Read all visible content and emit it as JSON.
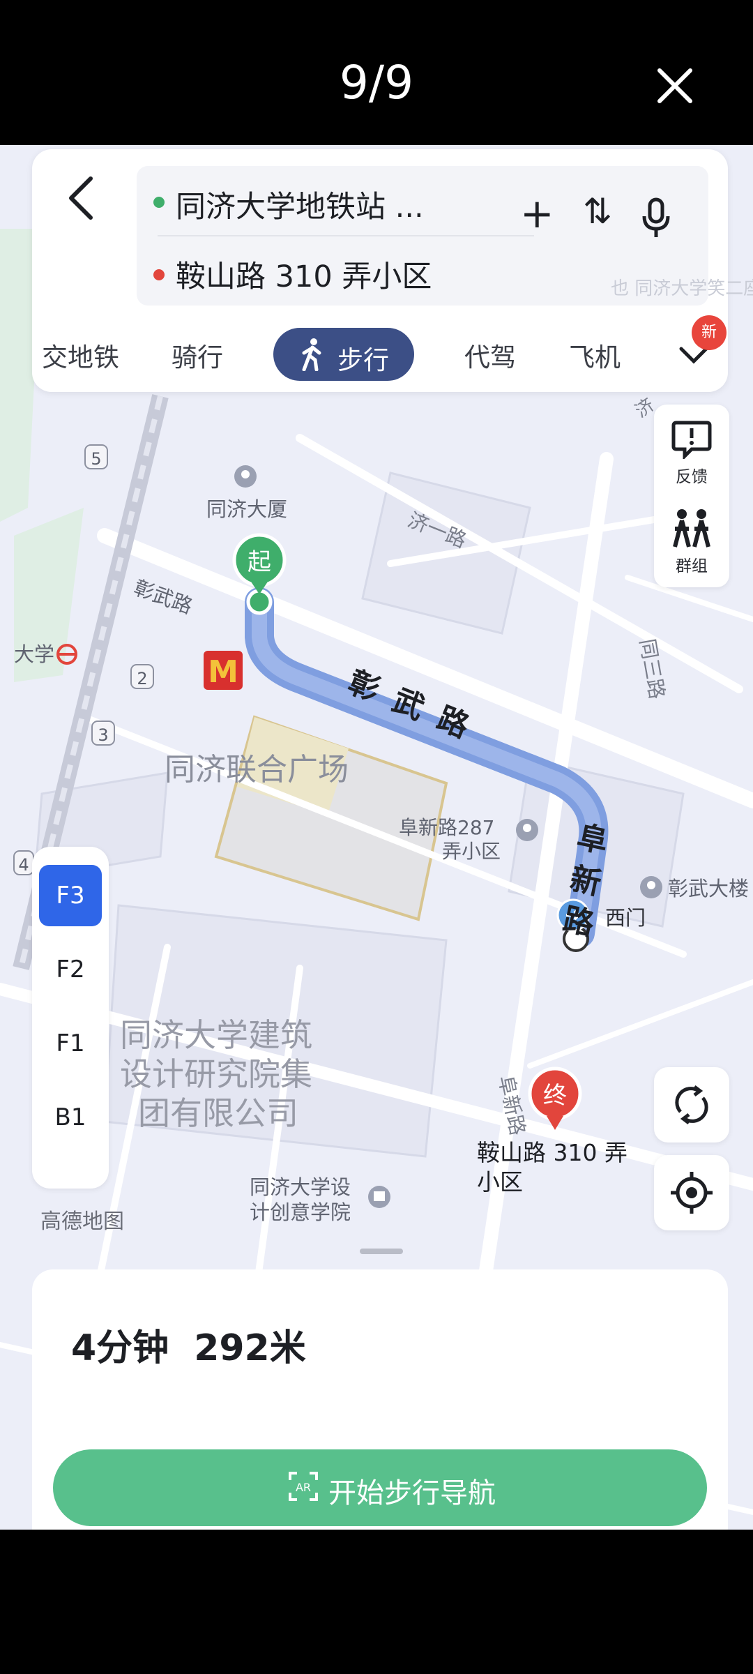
{
  "viewer": {
    "page_counter": "9/9"
  },
  "route": {
    "origin": "同济大学地铁站 ...",
    "destination": "鞍山路 310 弄小区",
    "faded_hint": "也 同济大学笑二座能"
  },
  "toolbar": {
    "add": "+",
    "swap": "⇅"
  },
  "modes": [
    {
      "label": "交地铁",
      "active": false
    },
    {
      "label": "骑行",
      "active": false
    },
    {
      "label": "步行",
      "active": true
    },
    {
      "label": "代驾",
      "active": false
    },
    {
      "label": "飞机",
      "active": false
    }
  ],
  "new_badge": "新",
  "side": {
    "feedback": "反馈",
    "group": "群组"
  },
  "floors": [
    {
      "label": "F3",
      "active": true
    },
    {
      "label": "F2",
      "active": false
    },
    {
      "label": "F1",
      "active": false
    },
    {
      "label": "B1",
      "active": false
    }
  ],
  "map": {
    "start_marker": "起",
    "end_marker": "终",
    "road_main": [
      "彰",
      "武",
      "路"
    ],
    "road_fuxin": [
      "阜",
      "新",
      "路"
    ],
    "road_fuxin_small": "阜新路",
    "road_zhangwu_small": "彰武路",
    "road_jiyi": "济一路",
    "road_tongsan": "同三路",
    "poi_tongji_tower": "同济大厦",
    "poi_plaza": "同济联合广场",
    "poi_fuxin_287_l1": "阜新路287",
    "poi_fuxin_287_l2": "弄小区",
    "poi_west_gate": "西门",
    "poi_zhangwu": "彰武大楼",
    "poi_design_inst": [
      "同济大学建筑",
      "设计研究院集",
      "团有限公司"
    ],
    "poi_creative": [
      "同济大学设",
      "计创意学院"
    ],
    "destination_label": [
      "鞍山路 310 弄",
      "小区"
    ],
    "station_partial": "大学",
    "stop_5": "5",
    "stop_2": "2",
    "stop_3": "3",
    "stop_4": "4",
    "road_partial_ji": "济",
    "mcd": "M"
  },
  "brand": "高德地图",
  "summary": {
    "time": "4分钟",
    "distance": "292米"
  },
  "start_nav": "开始步行导航",
  "colors": {
    "route": "#7f9ee0",
    "start": "#3fae6b",
    "end": "#e2453c",
    "active_mode": "#3c4f86",
    "floor_active": "#2f66e8",
    "cta": "#58c08c"
  }
}
